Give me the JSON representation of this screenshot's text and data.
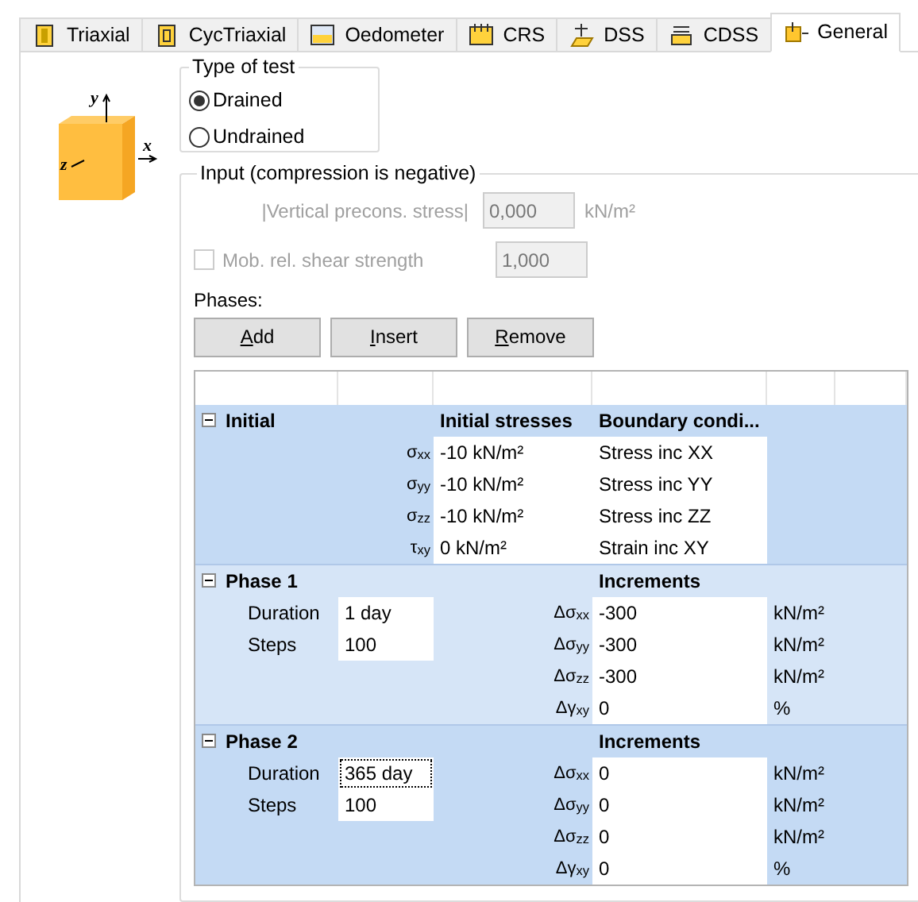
{
  "tabs": [
    {
      "label": "Triaxial",
      "selected": false
    },
    {
      "label": "CycTriaxial",
      "selected": false
    },
    {
      "label": "Oedometer",
      "selected": false
    },
    {
      "label": "CRS",
      "selected": false
    },
    {
      "label": "DSS",
      "selected": false
    },
    {
      "label": "CDSS",
      "selected": false
    },
    {
      "label": "General",
      "selected": true
    }
  ],
  "axes": [
    "y",
    "x",
    "z"
  ],
  "type_of_test": {
    "title": "Type of test",
    "options": [
      {
        "label": "Drained",
        "selected": true
      },
      {
        "label": "Undrained",
        "selected": false
      }
    ]
  },
  "input": {
    "title": "Input (compression is negative)",
    "precons": {
      "label": "|Vertical precons. stress|",
      "value": "0,000",
      "unit": "kN/m²",
      "disabled": true
    },
    "mob": {
      "label": "Mob. rel. shear strength",
      "value": "1,000",
      "checked": false,
      "disabled": true
    },
    "phases_label": "Phases:",
    "buttons": [
      "Add",
      "Insert",
      "Remove"
    ]
  },
  "table": {
    "sections": [
      {
        "kind": "initial",
        "title": "Initial",
        "expanded": true,
        "selected": true,
        "headers": [
          "Initial stresses",
          "Boundary condi..."
        ],
        "rows": [
          {
            "symbol": "σ$_{xx}$",
            "value": "-10 kN/m²",
            "condition": "Stress inc XX"
          },
          {
            "symbol": "σ$_{yy}$",
            "value": "-10 kN/m²",
            "condition": "Stress inc YY"
          },
          {
            "symbol": "σ$_{zz}$",
            "value": "-10 kN/m²",
            "condition": "Stress inc ZZ"
          },
          {
            "symbol": "τ$_{xy}$",
            "value": "0 kN/m²",
            "condition": "Strain inc XY"
          }
        ]
      },
      {
        "kind": "phase",
        "title": "Phase 1",
        "expanded": true,
        "selected": false,
        "headers": [
          "Increments"
        ],
        "fields": [
          {
            "label": "Duration",
            "value": "1 day",
            "focused": false
          },
          {
            "label": "Steps",
            "value": "100",
            "focused": false
          }
        ],
        "rows": [
          {
            "symbol": "Δσ$_{xx}$",
            "value": "-300",
            "unit": "kN/m²"
          },
          {
            "symbol": "Δσ$_{yy}$",
            "value": "-300",
            "unit": "kN/m²"
          },
          {
            "symbol": "Δσ$_{zz}$",
            "value": "-300",
            "unit": "kN/m²"
          },
          {
            "symbol": "Δγ$_{xy}$",
            "value": "0",
            "unit": "%"
          }
        ]
      },
      {
        "kind": "phase",
        "title": "Phase 2",
        "expanded": true,
        "selected": true,
        "headers": [
          "Increments"
        ],
        "fields": [
          {
            "label": "Duration",
            "value": "365 day",
            "focused": true
          },
          {
            "label": "Steps",
            "value": "100",
            "focused": false
          }
        ],
        "rows": [
          {
            "symbol": "Δσ$_{xx}$",
            "value": "0",
            "unit": "kN/m²"
          },
          {
            "symbol": "Δσ$_{yy}$",
            "value": "0",
            "unit": "kN/m²"
          },
          {
            "symbol": "Δσ$_{zz}$",
            "value": "0",
            "unit": "kN/m²"
          },
          {
            "symbol": "Δγ$_{xy}$",
            "value": "0",
            "unit": "%"
          }
        ]
      }
    ]
  }
}
